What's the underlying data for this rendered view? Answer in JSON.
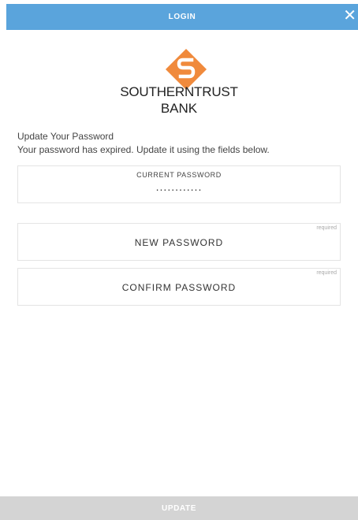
{
  "header": {
    "title": "LOGIN",
    "close_icon": "close-icon",
    "color": "#5aa4dc"
  },
  "brand": {
    "line1": "SOUTHERNTRUST",
    "line2": "BANK",
    "logo_icon": "southerntrust-logo-icon",
    "logo_color": "#f08a3c"
  },
  "intro": {
    "title": "Update Your Password",
    "description": "Your password has expired. Update it using the fields below."
  },
  "fields": {
    "current": {
      "label": "CURRENT PASSWORD",
      "value": "............"
    },
    "new": {
      "placeholder": "NEW PASSWORD",
      "required": "required"
    },
    "confirm": {
      "placeholder": "CONFIRM PASSWORD",
      "required": "required"
    }
  },
  "footer": {
    "button_label": "UPDATE",
    "color": "#d4d4d4"
  }
}
